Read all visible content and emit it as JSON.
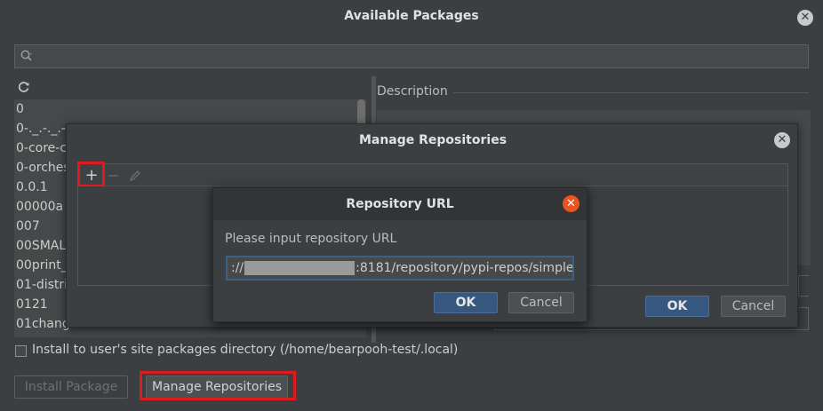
{
  "main_window": {
    "title": "Available Packages",
    "search": {
      "placeholder": "",
      "value": ""
    },
    "package_list": [
      "0",
      "0-._.-._.-",
      "0-core-cl",
      "0-orches",
      "0.0.1",
      "00000a",
      "007",
      "00SMALI",
      "00print_",
      "01-distri",
      "0121",
      "01changer"
    ],
    "description_label": "Description",
    "install_checkbox_label": "Install to user's site packages directory (/home/bearpooh-test/.local)",
    "install_button": "Install Package",
    "manage_button": "Manage Repositories"
  },
  "manage_repositories": {
    "title": "Manage Repositories",
    "ok": "OK",
    "cancel": "Cancel"
  },
  "repository_url": {
    "title": "Repository URL",
    "prompt": "Please input repository URL",
    "url_prefix": "://",
    "url_suffix": ":8181/repository/pypi-repos/simple",
    "ok": "OK",
    "cancel": "Cancel"
  },
  "colors": {
    "background": "#3c3f41",
    "highlight": "#e0191f",
    "ok_button": "#365880",
    "close_orange": "#e95420"
  },
  "icons": [
    "search-icon",
    "refresh-icon",
    "close-icon",
    "add-icon",
    "remove-icon",
    "edit-icon"
  ]
}
